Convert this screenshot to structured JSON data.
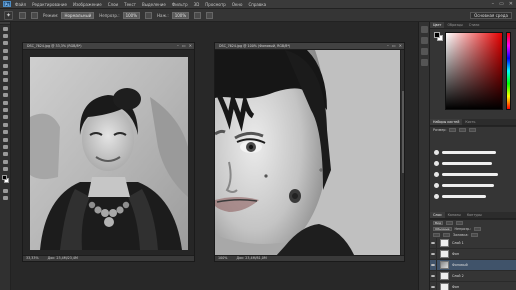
{
  "menu": {
    "logo": "Ps",
    "items": [
      "Файл",
      "Редактирование",
      "Изображение",
      "Слои",
      "Текст",
      "Выделение",
      "Фильтр",
      "3D",
      "Просмотр",
      "Окно",
      "Справка"
    ]
  },
  "options_bar": {
    "tool_glyph": "✦",
    "mode_label": "Режим:",
    "mode_value": "Нормальный",
    "opacity_label": "Непрозр.:",
    "opacity_value": "100%",
    "flow_label": "Наж.:",
    "flow_value": "100%",
    "workspace": "Основная среда"
  },
  "doc_left": {
    "title": "DSC_7624.jpg @ 33,3% (RGB/8*)",
    "zoom": "33,33%",
    "doc_size": "Док: 23,4М/23,4М"
  },
  "doc_right": {
    "title": "DSC_7624.jpg @ 100% (Фоновый, RGB/8*)",
    "zoom": "100%",
    "doc_size": "Док: 23,4М/81,0М"
  },
  "color_panel": {
    "tabs": [
      "Цвет",
      "Образцы",
      "Стили"
    ],
    "picker_hue": "#e60000"
  },
  "brush_panel": {
    "tabs": [
      "Наборы кистей",
      "Кисть"
    ],
    "size_label": "Размер:"
  },
  "layers_panel": {
    "tabs": [
      "Слои",
      "Каналы",
      "Контуры"
    ],
    "kind_label": "Вид",
    "blend_mode": "Обычные",
    "opacity_label": "Непрозр.:",
    "fill_label": "Заливка:",
    "layers": [
      {
        "name": "Слой 1",
        "thumb": "blank",
        "active": false
      },
      {
        "name": "Фон",
        "thumb": "blank",
        "active": false
      },
      {
        "name": "Фоновый",
        "thumb": "photo",
        "active": true
      },
      {
        "name": "Слой 2",
        "thumb": "blank",
        "active": false
      },
      {
        "name": "Фон",
        "thumb": "blank",
        "active": false
      }
    ]
  },
  "window_controls": [
    "–",
    "▭",
    "✕"
  ]
}
